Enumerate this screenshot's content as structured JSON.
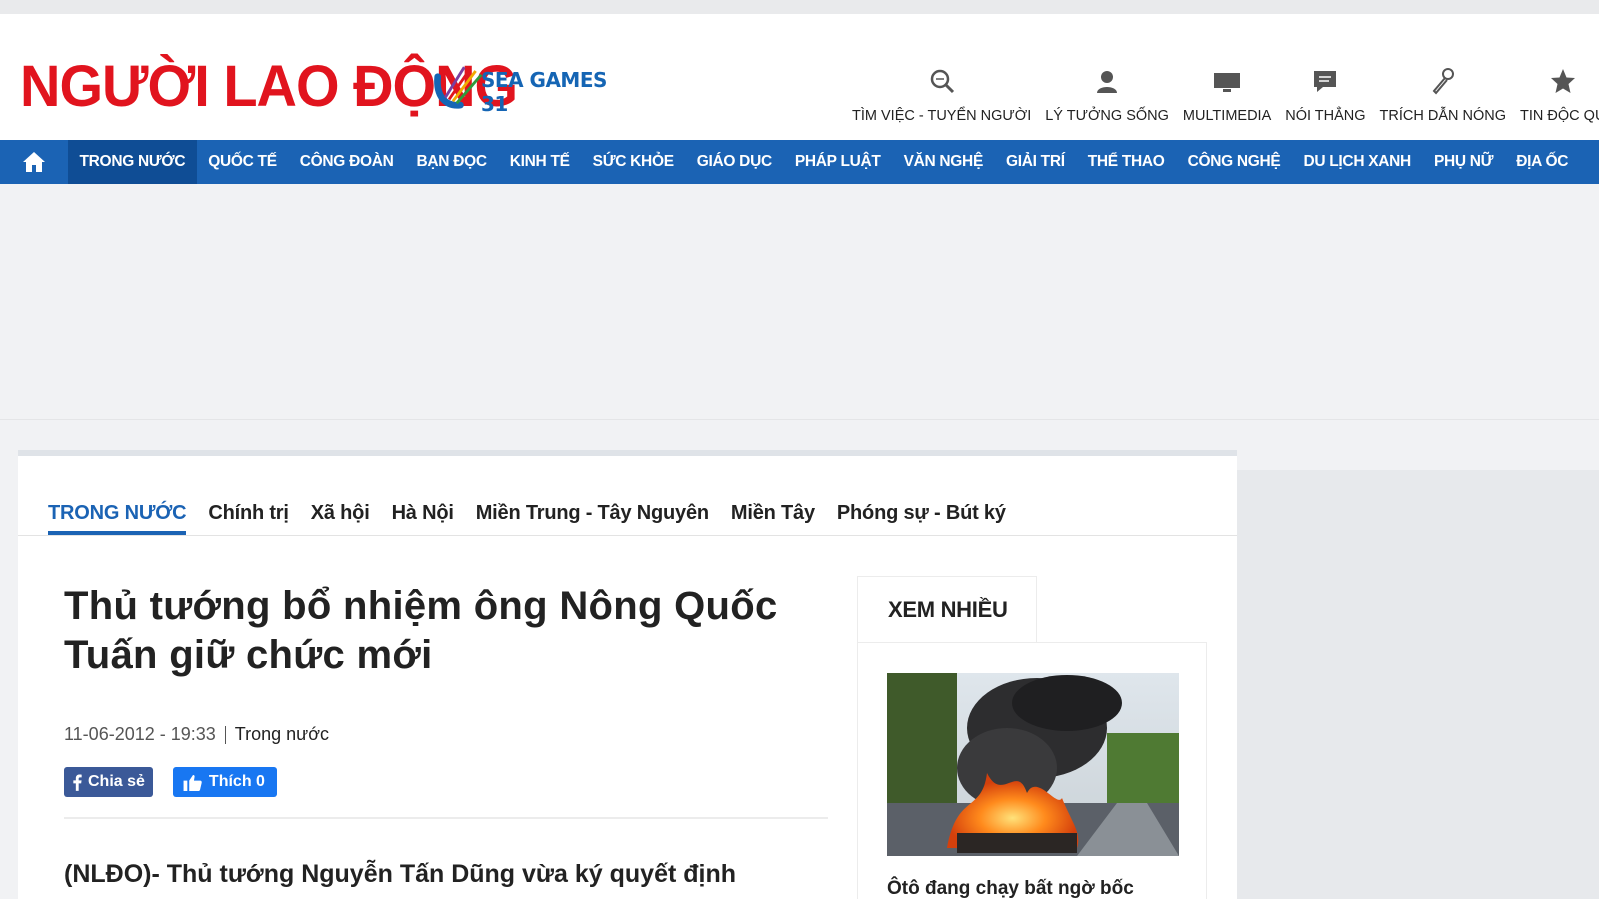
{
  "brand": {
    "logo": "NGƯỜI LAO ĐỘNG",
    "event_logo": "SEA GAMES 31"
  },
  "quick_links": [
    {
      "label": "TÌM VIỆC - TUYỂN NGƯỜI",
      "icon": "search-icon"
    },
    {
      "label": "LÝ TƯỞNG SỐNG",
      "icon": "person-icon"
    },
    {
      "label": "MULTIMEDIA",
      "icon": "monitor-icon"
    },
    {
      "label": "NÓI THẲNG",
      "icon": "chat-icon"
    },
    {
      "label": "TRÍCH DẪN NÓNG",
      "icon": "microphone-icon"
    },
    {
      "label": "TIN ĐỘC QU",
      "icon": "star-icon"
    }
  ],
  "nav": {
    "items": [
      "TRONG NƯỚC",
      "QUỐC TẾ",
      "CÔNG ĐOÀN",
      "BẠN ĐỌC",
      "KINH TẾ",
      "SỨC KHỎE",
      "GIÁO DỤC",
      "PHÁP LUẬT",
      "VĂN NGHỆ",
      "GIẢI TRÍ",
      "THỂ THAO",
      "CÔNG NGHỆ",
      "DU LỊCH XANH",
      "PHỤ NỮ",
      "ĐỊA ỐC"
    ],
    "active_index": 0
  },
  "subnav": {
    "items": [
      "TRONG NƯỚC",
      "Chính trị",
      "Xã hội",
      "Hà Nội",
      "Miền Trung - Tây Nguyên",
      "Miền Tây",
      "Phóng sự - Bút ký"
    ]
  },
  "article": {
    "title_line1": "Thủ tướng bổ nhiệm ông Nông Quốc",
    "title_line2": "Tuấn giữ chức mới",
    "date": "11-06-2012 - 19:33",
    "category": "Trong nước",
    "share_label": "Chia sẻ",
    "like_label": "Thích 0",
    "lead": "(NLĐO)- Thủ tướng Nguyễn Tấn Dũng vừa ký quyết định"
  },
  "sidebar": {
    "tab_label": "XEM NHIỀU",
    "caption": "Ôtô đang chạy bất ngờ bốc"
  },
  "colors": {
    "brand_red": "#e1141e",
    "nav_blue": "#1b63b4",
    "nav_active": "#0f4d95"
  }
}
